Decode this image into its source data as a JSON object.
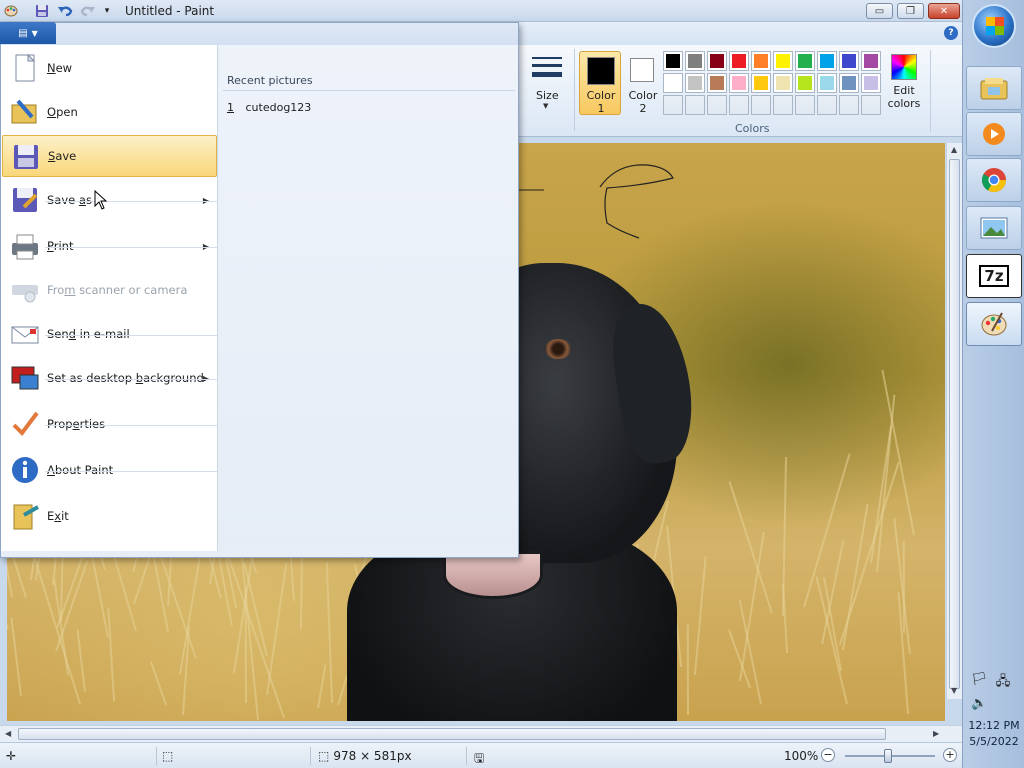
{
  "window": {
    "title": "Untitled - Paint",
    "buttons": {
      "minimize": "▭",
      "maximize": "❐",
      "close": "✕"
    }
  },
  "quick_access": [
    "paint-icon",
    "save-icon",
    "undo-icon",
    "redo-icon",
    "customize-icon"
  ],
  "ribbon": {
    "file_tab_glyph": "▤",
    "help_glyph": "?",
    "size_label": "Size",
    "color1_label_1": "Color",
    "color1_label_2": "1",
    "color2_label_1": "Color",
    "color2_label_2": "2",
    "edit_colors_1": "Edit",
    "edit_colors_2": "colors",
    "colors_group": "Colors",
    "color1_value": "#000000",
    "color2_value": "#ffffff",
    "palette_row1": [
      "#000000",
      "#7f7f7f",
      "#880015",
      "#ed1c24",
      "#ff7f27",
      "#fff200",
      "#22b14c",
      "#00a2e8",
      "#3f48cc",
      "#a349a4"
    ],
    "palette_row2": [
      "#ffffff",
      "#c3c3c3",
      "#b97a57",
      "#ffaec9",
      "#ffc90e",
      "#efe4b0",
      "#b5e61d",
      "#99d9ea",
      "#7092be",
      "#c8bfe7"
    ]
  },
  "file_menu": {
    "items": [
      {
        "pre": "",
        "key": "N",
        "post": "ew",
        "icon": "new-icon"
      },
      {
        "pre": "",
        "key": "O",
        "post": "pen",
        "icon": "open-icon"
      },
      {
        "pre": "",
        "key": "S",
        "post": "ave",
        "icon": "save-icon"
      },
      {
        "pre": "Save ",
        "key": "a",
        "post": "s",
        "icon": "save-as-icon"
      },
      {
        "pre": "",
        "key": "P",
        "post": "rint",
        "icon": "print-icon"
      },
      {
        "pre": "Fro",
        "key": "m",
        "post": " scanner or camera",
        "icon": "scanner-icon"
      },
      {
        "pre": "Sen",
        "key": "d",
        "post": " in e-mail",
        "icon": "email-icon"
      },
      {
        "pre": "Set as desktop ",
        "key": "b",
        "post": "ackground",
        "icon": "desktop-background-icon"
      },
      {
        "pre": "Prop",
        "key": "e",
        "post": "rties",
        "icon": "properties-icon"
      },
      {
        "pre": "",
        "key": "A",
        "post": "bout Paint",
        "icon": "about-icon"
      },
      {
        "pre": "E",
        "key": "x",
        "post": "it",
        "icon": "exit-icon"
      }
    ],
    "recent_title": "Recent pictures",
    "recent_items": [
      {
        "num": "1",
        "name": "cutedog123"
      }
    ]
  },
  "statusbar": {
    "dimensions": "978 × 581px",
    "zoom": "100%",
    "zoom_minus": "−",
    "zoom_plus": "+"
  },
  "taskbar": {
    "time": "12:12 PM",
    "date": "5/5/2022",
    "pinned": [
      "explorer-icon",
      "media-player-icon",
      "chrome-icon",
      "photo-viewer-icon",
      "7zip-icon",
      "paint-icon"
    ],
    "sevenzip_label": "7z"
  }
}
